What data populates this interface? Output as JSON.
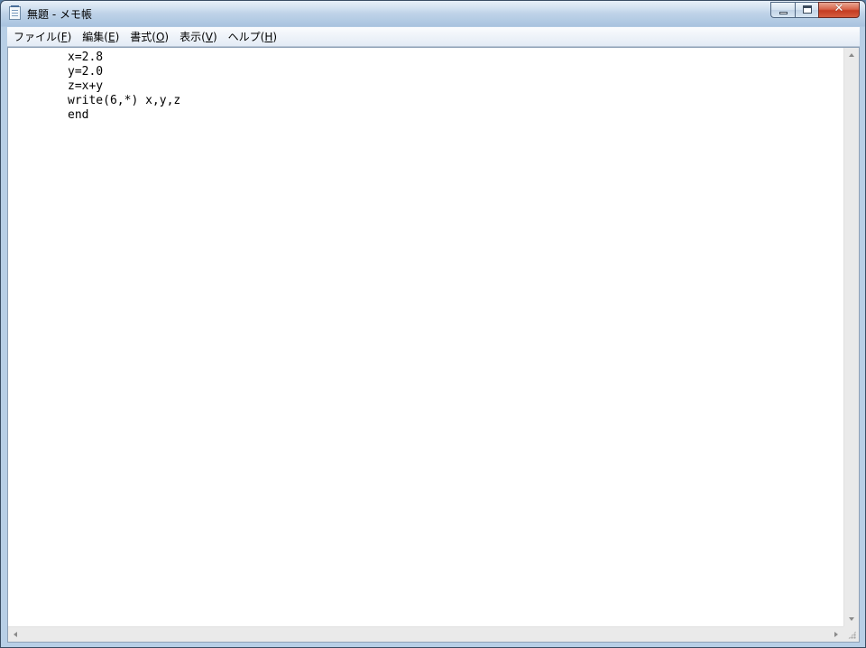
{
  "window": {
    "title": "無題 - メモ帳",
    "icon": "notepad-icon",
    "buttons": {
      "minimize_icon": "minimize-icon",
      "maximize_icon": "maximize-icon",
      "close_label": "✕"
    }
  },
  "menubar": {
    "items": [
      {
        "label": "ファイル(",
        "key": "F",
        "suffix": ")"
      },
      {
        "label": "編集(",
        "key": "E",
        "suffix": ")"
      },
      {
        "label": "書式(",
        "key": "O",
        "suffix": ")"
      },
      {
        "label": "表示(",
        "key": "V",
        "suffix": ")"
      },
      {
        "label": "ヘルプ(",
        "key": "H",
        "suffix": ")"
      }
    ]
  },
  "editor": {
    "lines": [
      "x=2.8",
      "y=2.0",
      "z=x+y",
      "write(6,*) x,y,z",
      "end"
    ]
  },
  "colors": {
    "titlebar": "#b3cbe4",
    "close_button": "#c43c22",
    "editor_background": "#ffffff"
  }
}
